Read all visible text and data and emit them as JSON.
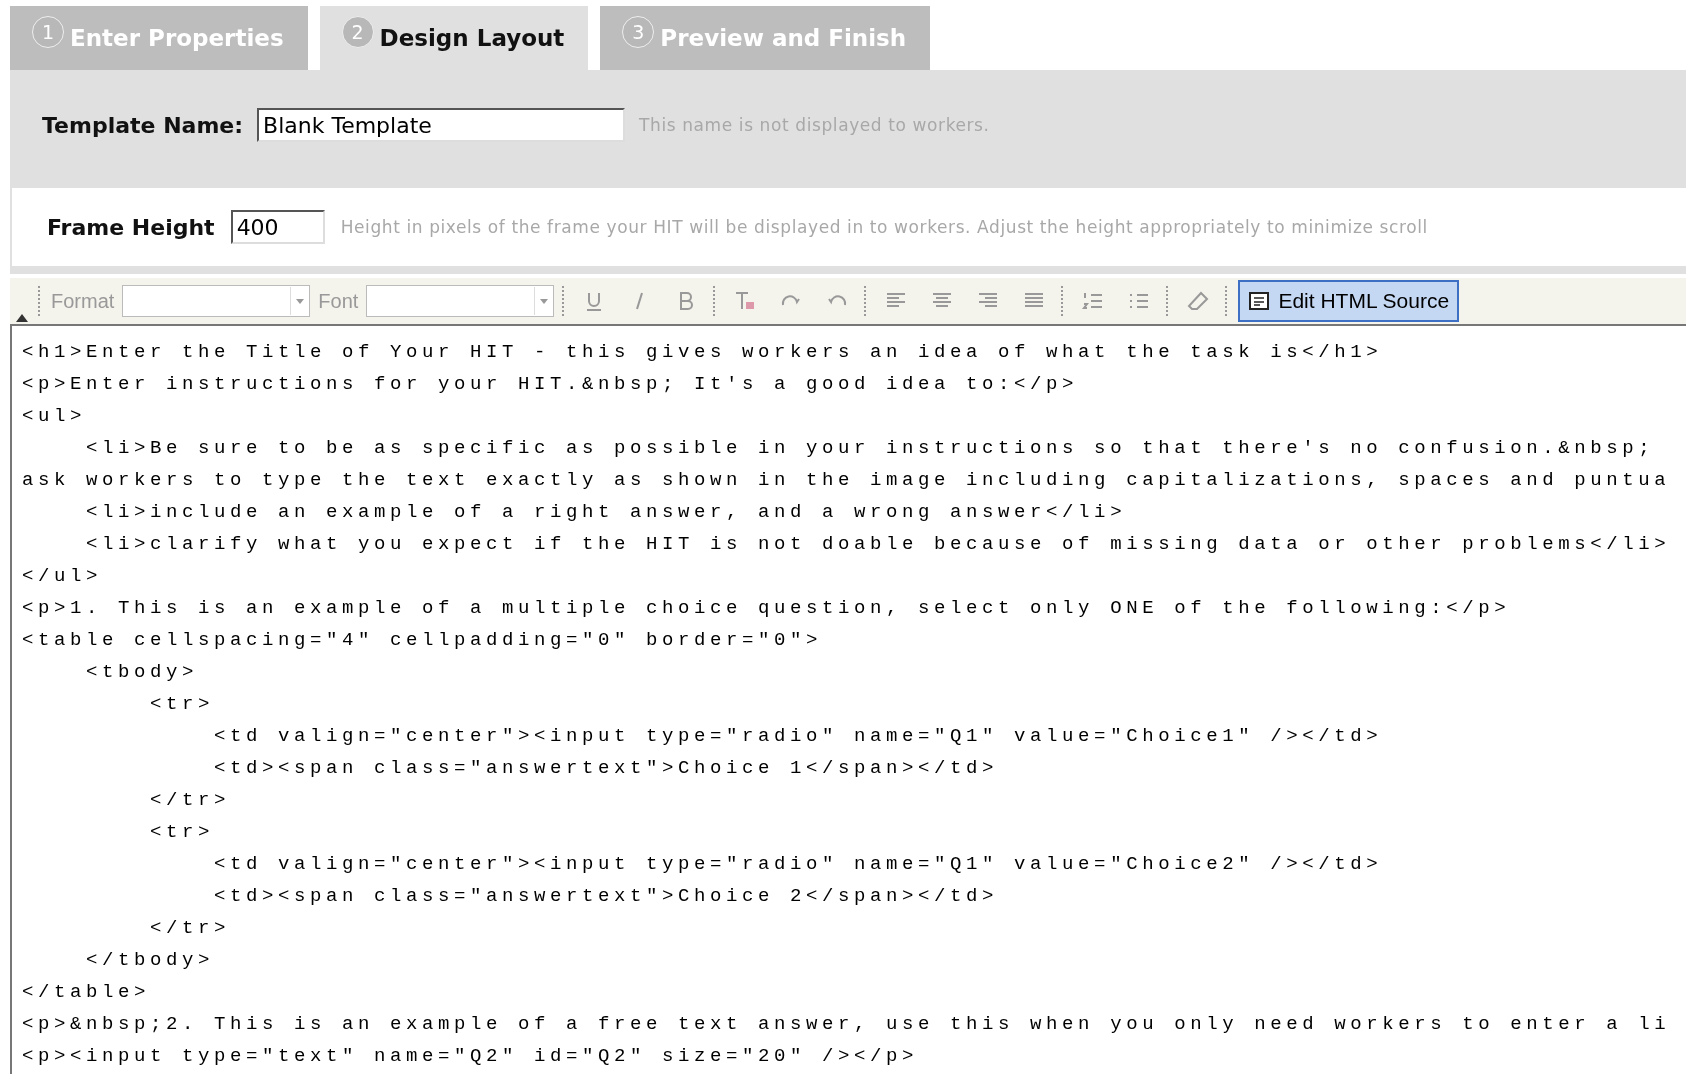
{
  "tabs": [
    {
      "number": "1",
      "label": "Enter Properties",
      "selected": false
    },
    {
      "number": "2",
      "label": "Design Layout",
      "selected": true
    },
    {
      "number": "3",
      "label": "Preview and Finish",
      "selected": false
    }
  ],
  "template_name": {
    "label": "Template Name:",
    "value": "Blank Template",
    "hint": "This name is not displayed to workers."
  },
  "frame_height": {
    "label": "Frame Height",
    "value": "400",
    "hint": "Height in pixels of the frame your HIT will be displayed in to workers. Adjust the height appropriately to minimize scroll"
  },
  "toolbar": {
    "dropdowns": [
      {
        "label": "Format"
      },
      {
        "label": "Font"
      }
    ],
    "source_toggle": {
      "label": "Edit HTML Source",
      "selected": true
    }
  },
  "source_lines": [
    "<h1>Enter the Title of Your HIT - this gives workers an idea of what the task is</h1>",
    "<p>Enter instructions for your HIT.&nbsp; It's a good idea to:</p>",
    "<ul>",
    "    <li>Be sure to be as specific as possible in your instructions so that there's no confusion.&nbsp;",
    "ask workers to type the text exactly as shown in the image including capitalizations, spaces and puntua",
    "    <li>include an example of a right answer, and a wrong answer</li>",
    "    <li>clarify what you expect if the HIT is not doable because of missing data or other problems</li>",
    "</ul>",
    "<p>1. This is an example of a multiple choice question, select only ONE of the following:</p>",
    "<table cellspacing=\"4\" cellpadding=\"0\" border=\"0\">",
    "    <tbody>",
    "        <tr>",
    "            <td valign=\"center\"><input type=\"radio\" name=\"Q1\" value=\"Choice1\" /></td>",
    "            <td><span class=\"answertext\">Choice 1</span></td>",
    "        </tr>",
    "        <tr>",
    "            <td valign=\"center\"><input type=\"radio\" name=\"Q1\" value=\"Choice2\" /></td>",
    "            <td><span class=\"answertext\">Choice 2</span></td>",
    "        </tr>",
    "    </tbody>",
    "</table>",
    "<p>&nbsp;2. This is an example of a free text answer, use this when you only need workers to enter a li",
    "<p><input type=\"text\" name=\"Q2\" id=\"Q2\" size=\"20\" /></p>"
  ]
}
